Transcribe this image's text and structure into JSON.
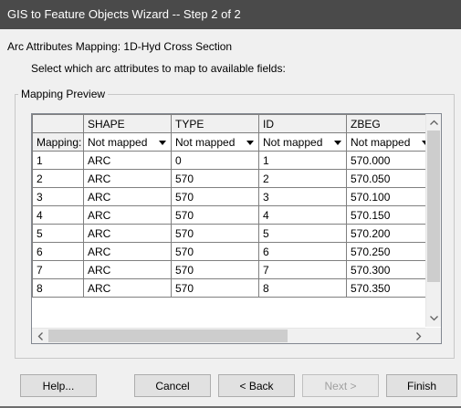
{
  "window": {
    "title": "GIS to Feature Objects Wizard -- Step 2 of 2"
  },
  "header": {
    "line1": "Arc Attributes Mapping:  1D-Hyd Cross Section",
    "line2": "Select which arc attributes to map to available fields:"
  },
  "group": {
    "legend": "Mapping Preview"
  },
  "grid": {
    "columns": [
      "SHAPE",
      "TYPE",
      "ID",
      "ZBEG"
    ],
    "mapping_row": {
      "label": "Mapping:",
      "values": [
        "Not mapped",
        "Not mapped",
        "Not mapped",
        "Not mapped"
      ]
    },
    "rows": [
      {
        "num": "1",
        "cells": [
          "ARC",
          "0",
          "1",
          "570.000"
        ]
      },
      {
        "num": "2",
        "cells": [
          "ARC",
          "570",
          "2",
          "570.050"
        ]
      },
      {
        "num": "3",
        "cells": [
          "ARC",
          "570",
          "3",
          "570.100"
        ]
      },
      {
        "num": "4",
        "cells": [
          "ARC",
          "570",
          "4",
          "570.150"
        ]
      },
      {
        "num": "5",
        "cells": [
          "ARC",
          "570",
          "5",
          "570.200"
        ]
      },
      {
        "num": "6",
        "cells": [
          "ARC",
          "570",
          "6",
          "570.250"
        ]
      },
      {
        "num": "7",
        "cells": [
          "ARC",
          "570",
          "7",
          "570.300"
        ]
      },
      {
        "num": "8",
        "cells": [
          "ARC",
          "570",
          "8",
          "570.350"
        ]
      }
    ]
  },
  "buttons": {
    "help": "Help...",
    "cancel": "Cancel",
    "back": "< Back",
    "next": "Next >",
    "finish": "Finish"
  },
  "icons": {
    "dropdown": "triangle-down-icon",
    "scroll_up": "chevron-up-icon",
    "scroll_down": "chevron-down-icon",
    "scroll_left": "chevron-left-icon",
    "scroll_right": "chevron-right-icon"
  }
}
